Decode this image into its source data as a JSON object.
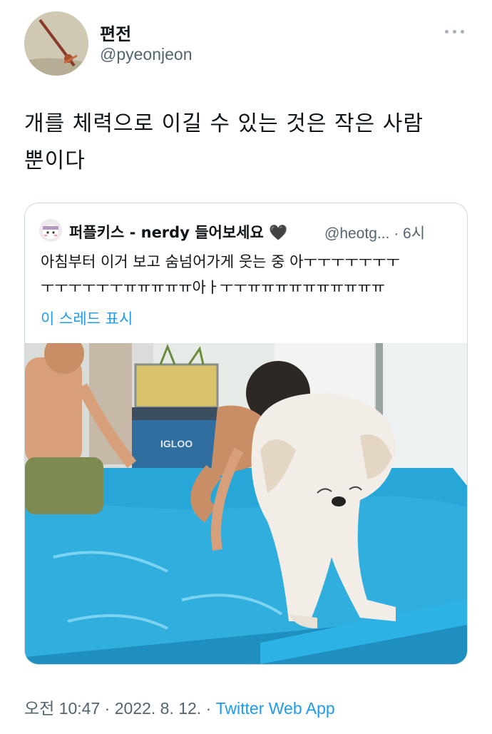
{
  "author": {
    "name": "편전",
    "handle": "@pyeonjeon"
  },
  "tweet": {
    "text": "개를 체력으로 이길 수 있는 것은 작은 사람\n뿐이다"
  },
  "quoted": {
    "name": "퍼플키스 - nerdy 들어보세요",
    "name_emoji": "🖤",
    "handle": "@heotg... · 6시",
    "text_line1": "아침부터 이거 보고 숨넘어가게 웃는 중 아ㅜㅜㅜㅜㅜㅜㅜ",
    "text_line2": "ㅜㅜㅜㅜㅜㅜㅠㅠㅠㅠㅠ아ㅏㅜㅜㅠㅠㅠㅠㅠㅠㅠㅠㅠㅠ",
    "show_thread": "이 스레드 표시",
    "photo_sign": "IGLOO"
  },
  "footer": {
    "time": "오전 10:47 · 2022. 8. 12. · ",
    "app": "Twitter Web App"
  },
  "colors": {
    "link": "#1d9bf0",
    "secondary": "#536471",
    "pool": "#27a6d8"
  }
}
